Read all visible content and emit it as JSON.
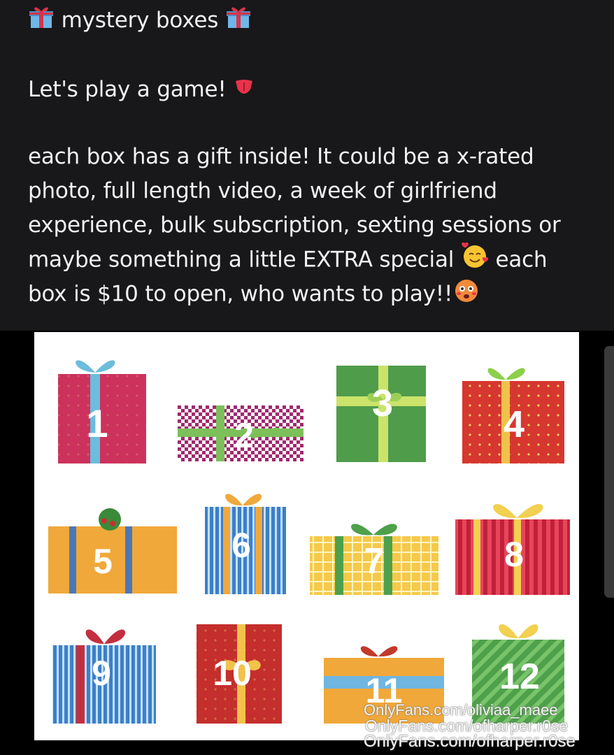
{
  "post": {
    "title_line": "mystery boxes",
    "line2": "Let's play a game!",
    "body_lines": [
      "each box has a gift inside! It could be a x-rated",
      "photo, full length video, a week of girlfriend",
      "experience, bulk subscription, sexting sessions or",
      "maybe something a little EXTRA special",
      "each",
      "box is $10 to open, who wants to play!!"
    ],
    "emojis": {
      "title_left": "wrapped-gift-icon",
      "title_right": "wrapped-gift-icon",
      "tongue": "tongue-icon",
      "hearts_face": "smiling-face-with-hearts-icon",
      "hot_face": "flushed-hot-face-icon"
    }
  },
  "image": {
    "box_numbers": [
      "1",
      "2",
      "3",
      "4",
      "5",
      "6",
      "7",
      "8",
      "9",
      "10",
      "11",
      "12"
    ],
    "watermarks": [
      "OnlyFans.com/oliviaa_maee",
      "OnlyFans.com/ofharper.r0se",
      "OnlyFans.com/ofharper.r0se"
    ]
  },
  "colors": {
    "background": "#18181a",
    "text": "#f2f2f2"
  }
}
